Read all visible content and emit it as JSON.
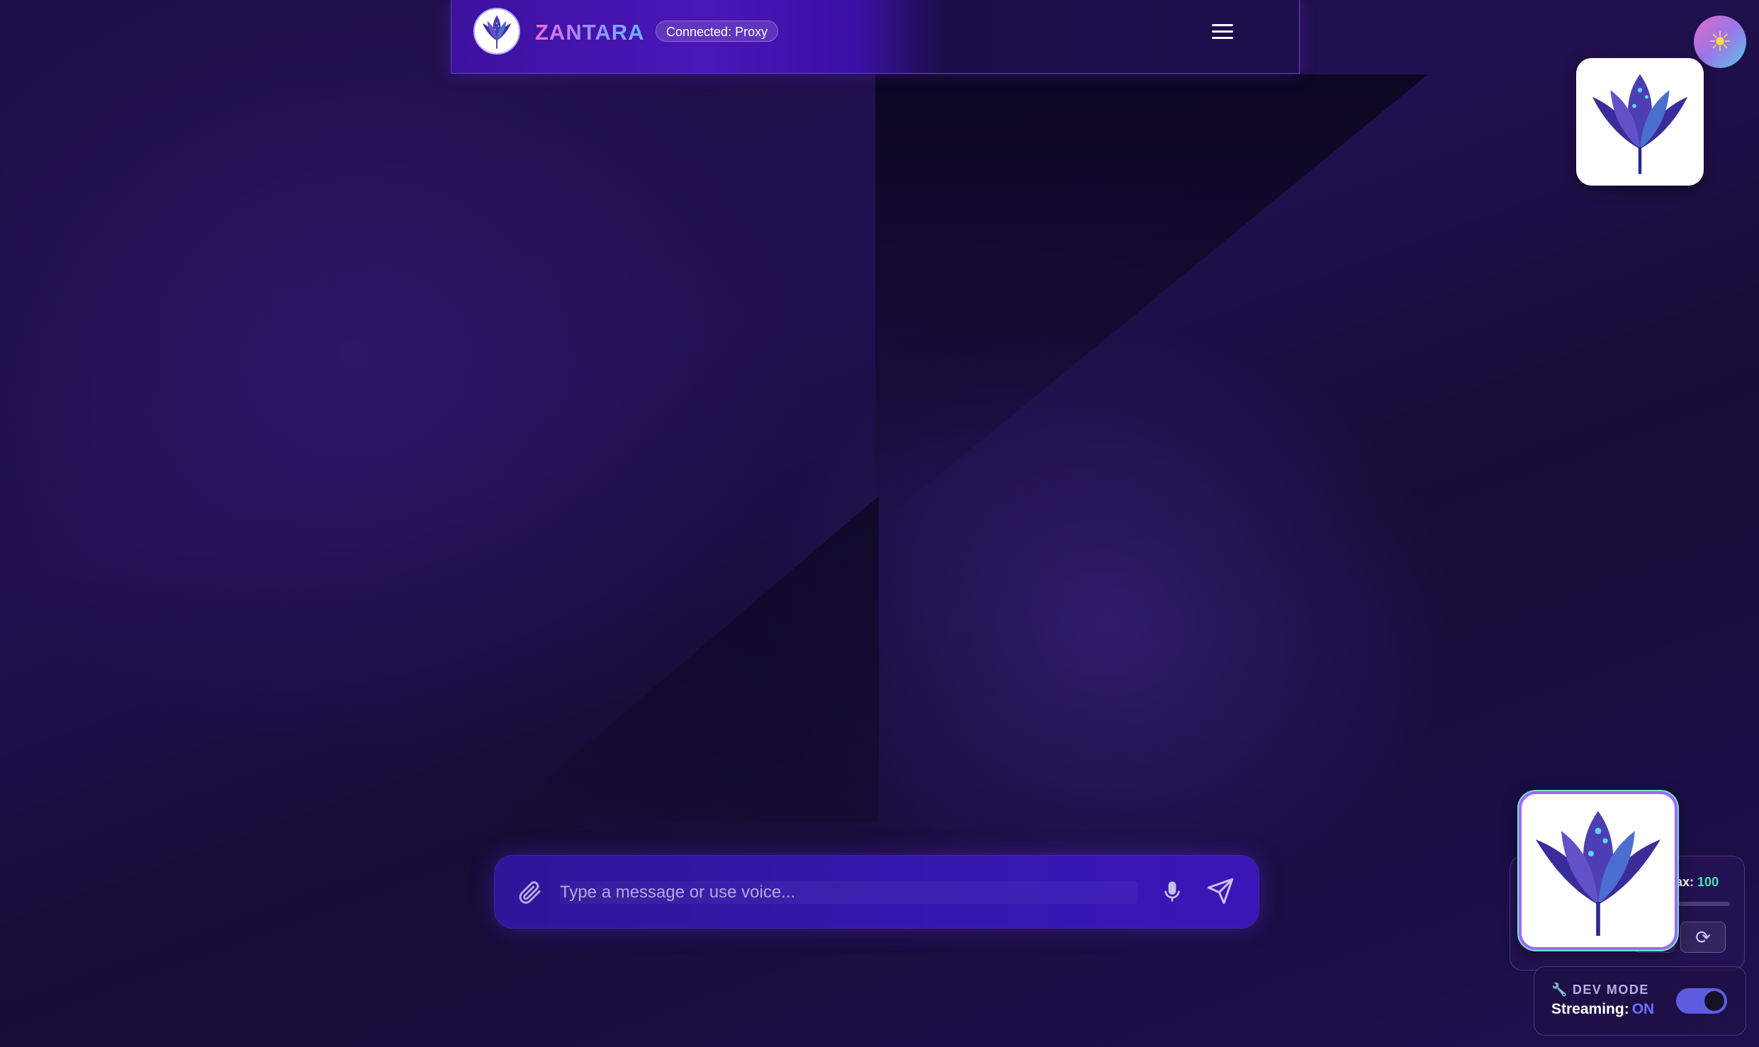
{
  "header": {
    "brand": "ZANTARA",
    "status_badge": "Connected: Proxy",
    "menu_icon": "hamburger-menu-icon",
    "logo_icon": "lotus-icon"
  },
  "theme_toggle": {
    "icon": "sun-icon",
    "glyph": "☀"
  },
  "composer": {
    "placeholder": "Type a message or use voice...",
    "value": "",
    "attach_icon": "paperclip-icon",
    "mic_icon": "microphone-icon",
    "send_icon": "send-icon"
  },
  "stats_panel": {
    "max_label": "lax:",
    "max_value": "100",
    "refresh_icon": "refresh-icon",
    "refresh_glyph": "⟳"
  },
  "dev_mode": {
    "wrench_glyph": "🔧",
    "title": "DEV MODE",
    "streaming_label": "Streaming:",
    "streaming_value": "ON",
    "toggle_on": true
  },
  "colors": {
    "brand_gradient": [
      "#f06bd0",
      "#9e8cff",
      "#6ab4ff"
    ],
    "accent": "#5e5ce0",
    "on_status": "#6f6cff",
    "max_value": "#4fe0a8",
    "background": "#1d0f45"
  }
}
